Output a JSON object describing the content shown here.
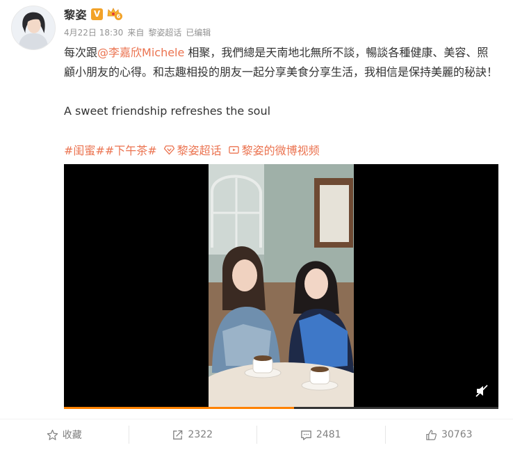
{
  "user": {
    "name": "黎姿",
    "verified_mark": "V",
    "vip_level": "6",
    "avatar_icon": "avatar-photo"
  },
  "meta": {
    "date": "4月22日 18:30",
    "from_label": "来自",
    "source": "黎姿超话",
    "edited": "已编辑"
  },
  "post": {
    "part1": "每次跟",
    "mention": "@李嘉欣Michele",
    "part2": " 相聚，我們總是天南地北無所不談，暢談各種健康、美容、照顧小朋友的心得。和志趣相投的朋友一起分享美食分享生活，我相信是保持美麗的秘訣！",
    "english": "A sweet friendship refreshes the soul"
  },
  "tags": {
    "tag1": "#闺蜜#",
    "tag2": "#下午茶#",
    "supertopic": "黎姿超话",
    "supertopic_icon": "diamond-icon",
    "video": "黎姿的微博视频",
    "video_icon": "video-icon"
  },
  "video": {
    "progress": 0.53,
    "mute_icon": "mute-icon"
  },
  "actions": {
    "favorite": "收藏",
    "repost": "2322",
    "comment": "2481",
    "like": "30763"
  },
  "colors": {
    "accent": "#eb7350",
    "progress": "#ff8200",
    "muted": "#939393"
  }
}
